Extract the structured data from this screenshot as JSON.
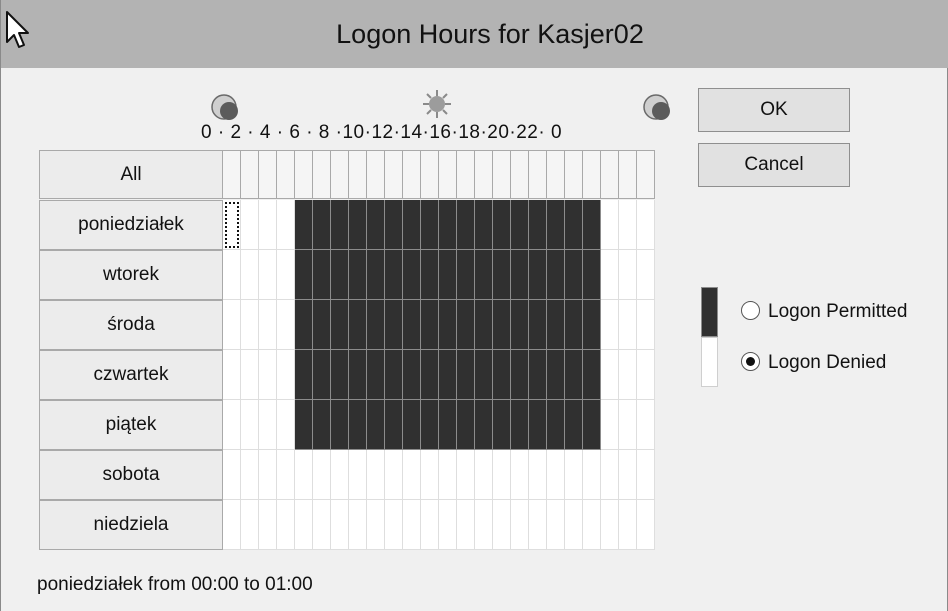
{
  "window": {
    "title": "Logon Hours for Kasjer02"
  },
  "header": {
    "hour_labels": "0 · 2 · 4 · 6 · 8 ·10·12·14·16·18·20·22· 0",
    "icons": [
      "moon-icon",
      "sun-icon",
      "moon-icon"
    ]
  },
  "grid": {
    "all_label": "All",
    "days": [
      "poniedziałek",
      "wtorek",
      "środa",
      "czwartek",
      "piątek",
      "sobota",
      "niedziela"
    ],
    "permitted_hours": [
      [
        4,
        5,
        6,
        7,
        8,
        9,
        10,
        11,
        12,
        13,
        14,
        15,
        16,
        17,
        18,
        19,
        20
      ],
      [
        4,
        5,
        6,
        7,
        8,
        9,
        10,
        11,
        12,
        13,
        14,
        15,
        16,
        17,
        18,
        19,
        20
      ],
      [
        4,
        5,
        6,
        7,
        8,
        9,
        10,
        11,
        12,
        13,
        14,
        15,
        16,
        17,
        18,
        19,
        20
      ],
      [
        4,
        5,
        6,
        7,
        8,
        9,
        10,
        11,
        12,
        13,
        14,
        15,
        16,
        17,
        18,
        19,
        20
      ],
      [
        4,
        5,
        6,
        7,
        8,
        9,
        10,
        11,
        12,
        13,
        14,
        15,
        16,
        17,
        18,
        19,
        20
      ],
      [],
      []
    ],
    "selected": {
      "day": 0,
      "hour": 0
    }
  },
  "buttons": {
    "ok": "OK",
    "cancel": "Cancel"
  },
  "legend": {
    "permitted_label": "Logon Permitted",
    "denied_label": "Logon Denied",
    "selected_option": "denied",
    "permitted_color": "#303030",
    "denied_color": "#ffffff"
  },
  "status": {
    "text": "poniedziałek from 00:00 to 01:00"
  }
}
